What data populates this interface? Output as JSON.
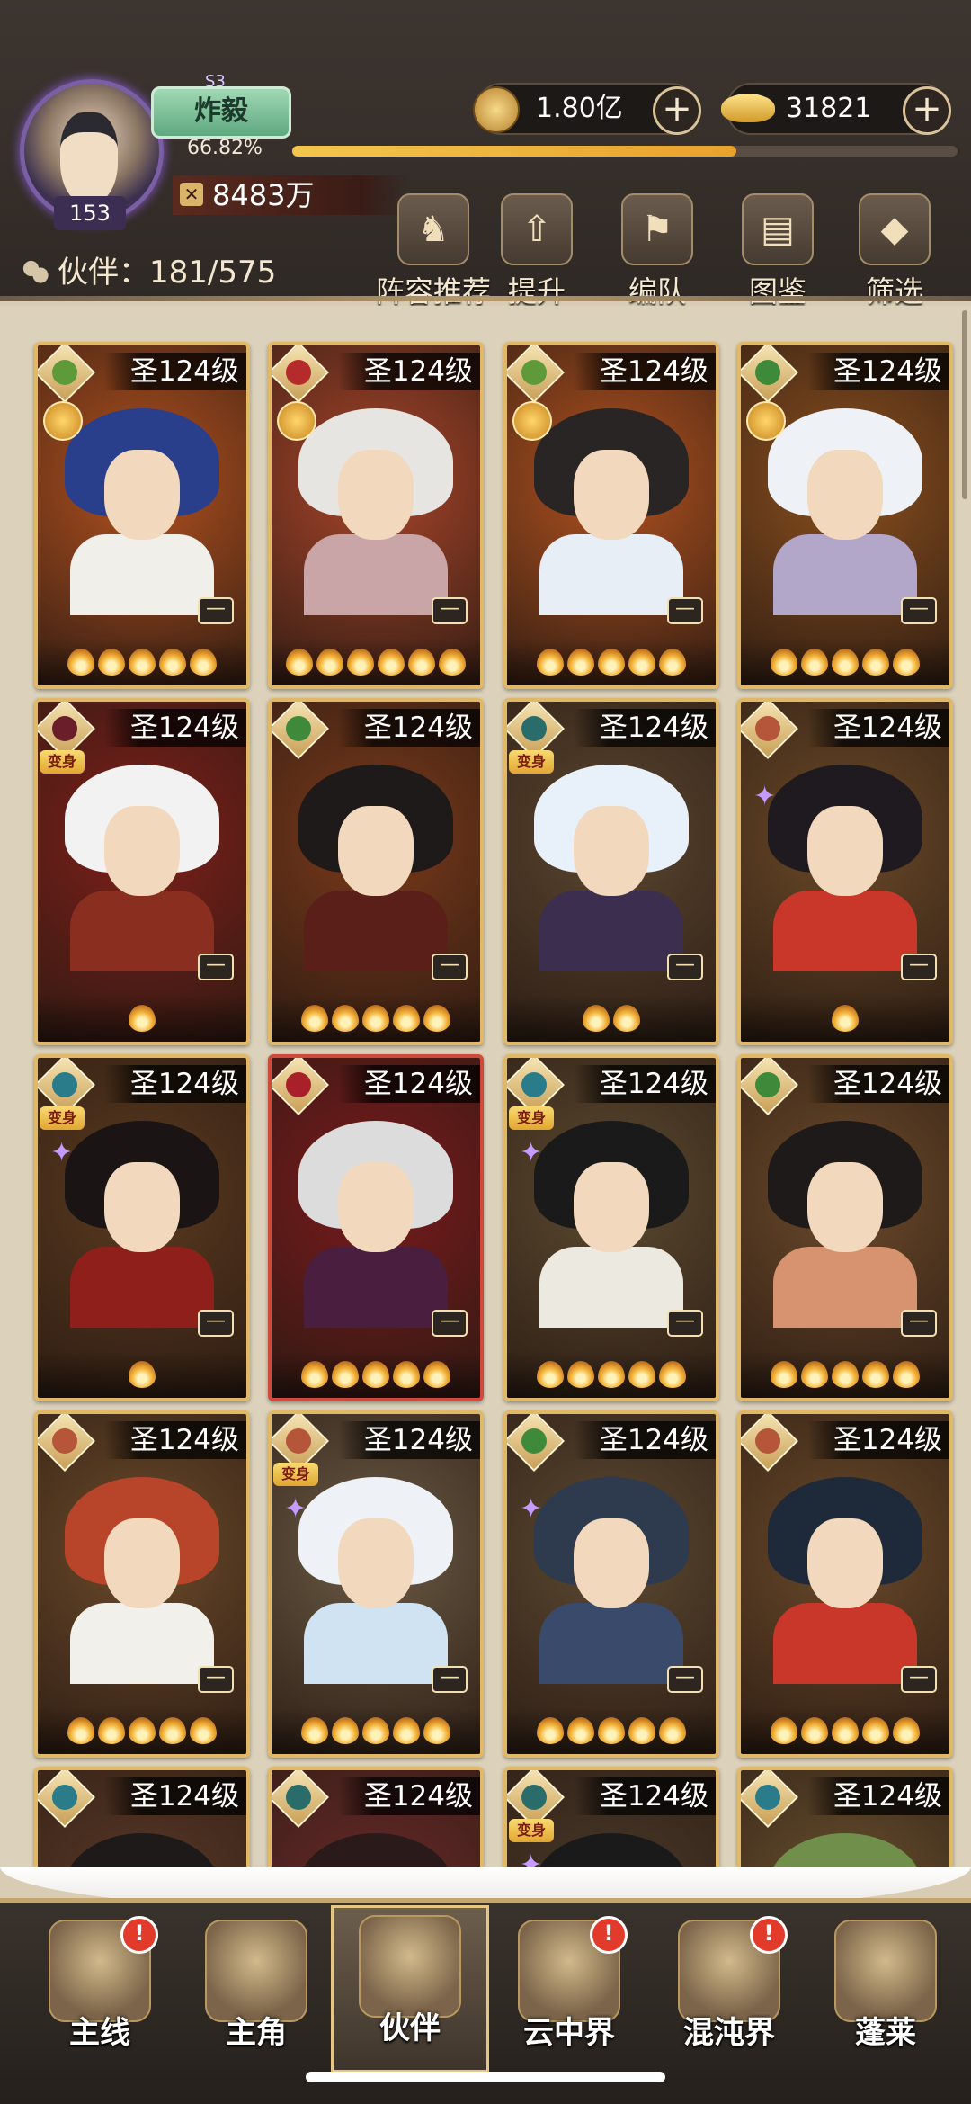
{
  "header": {
    "rank_tag": "S3",
    "title_badge": "炸毅",
    "exp_percent_text": "66.82%",
    "exp_fraction": 0.6682,
    "player_level": "153",
    "power_value": "8483万",
    "coins_value": "1.80亿",
    "ingots_value": "31821",
    "partner_count_label": "伙伴：181/575",
    "toolbar": [
      {
        "label": "阵容推荐",
        "icon": "lineup-recommend-icon"
      },
      {
        "label": "提升",
        "icon": "upgrade-icon"
      },
      {
        "label": "编队",
        "icon": "formation-icon"
      },
      {
        "label": "图鉴",
        "icon": "codex-icon"
      },
      {
        "label": "筛选",
        "icon": "filter-icon"
      }
    ]
  },
  "partners": [
    {
      "level": "圣124级",
      "tag": "",
      "flames": 5,
      "frame": "gold",
      "bg": "#b3511f",
      "hair": "#2a3f8c",
      "body": "#f0efe9",
      "elem": "#5f9a3a",
      "medal": true
    },
    {
      "level": "圣124级",
      "tag": "",
      "flames": 6,
      "frame": "gold",
      "bg": "#a9452a",
      "hair": "#e7e5e2",
      "body": "#c9a5a8",
      "elem": "#b52a2a",
      "medal": true
    },
    {
      "level": "圣124级",
      "tag": "",
      "flames": 5,
      "frame": "gold",
      "bg": "#b1521f",
      "hair": "#2a2525",
      "body": "#e8eef6",
      "elem": "#5f9a3a",
      "medal": true
    },
    {
      "level": "圣124级",
      "tag": "",
      "flames": 5,
      "frame": "gold",
      "bg": "#8a4f1e",
      "hair": "#eef1f6",
      "body": "#b2a6c9",
      "elem": "#3f8a3a",
      "medal": true
    },
    {
      "level": "圣124级",
      "tag": "变身",
      "flames": 1,
      "frame": "gold",
      "bg": "#7f1f1a",
      "hair": "#f2f2f2",
      "body": "#8a2e1f",
      "elem": "#6a1e2a",
      "medal": false
    },
    {
      "level": "圣124级",
      "tag": "",
      "flames": 5,
      "frame": "gold",
      "bg": "#7b3a1a",
      "hair": "#1f1a1a",
      "body": "#5b1f1a",
      "elem": "#3f8a3a",
      "medal": false
    },
    {
      "level": "圣124级",
      "tag": "变身",
      "flames": 2,
      "frame": "gold",
      "bg": "#5a4630",
      "hair": "#e8f0fa",
      "body": "#3b2e4e",
      "elem": "#2a6c6a",
      "medal": false
    },
    {
      "level": "圣124级",
      "tag": "",
      "flames": 1,
      "frame": "gold",
      "bg": "#6b4a28",
      "hair": "#1f1a1f",
      "body": "#c8372a",
      "elem": "#b5563a",
      "medal": false,
      "sparkle": true
    },
    {
      "level": "圣124级",
      "tag": "变身",
      "flames": 1,
      "frame": "gold",
      "bg": "#5a3a1f",
      "hair": "#1a1414",
      "body": "#8f1f1a",
      "elem": "#2a7c8a",
      "medal": false,
      "sparkle": true
    },
    {
      "level": "圣124级",
      "tag": "",
      "flames": 5,
      "frame": "red",
      "bg": "#7a1a1c",
      "hair": "#dcdcdc",
      "body": "#4a1e3e",
      "elem": "#a8202a",
      "medal": false
    },
    {
      "level": "圣124级",
      "tag": "变身",
      "flames": 5,
      "frame": "gold",
      "bg": "#5b4a30",
      "hair": "#1a1a1a",
      "body": "#ece9e1",
      "elem": "#2a7c8a",
      "medal": false,
      "sparkle": true
    },
    {
      "level": "圣124级",
      "tag": "",
      "flames": 5,
      "frame": "gold",
      "bg": "#6b4a2a",
      "hair": "#1f1a1a",
      "body": "#d7936f",
      "elem": "#3f8a3a",
      "medal": false
    },
    {
      "level": "圣124级",
      "tag": "",
      "flames": 5,
      "frame": "gold",
      "bg": "#6b4a2a",
      "hair": "#b8452a",
      "body": "#f2f0ea",
      "elem": "#b5563a",
      "medal": false
    },
    {
      "level": "圣124级",
      "tag": "变身",
      "flames": 5,
      "frame": "gold",
      "bg": "#6a5a44",
      "hair": "#eef2f7",
      "body": "#cfe3f2",
      "elem": "#b5563a",
      "medal": false,
      "sparkle": true
    },
    {
      "level": "圣124级",
      "tag": "",
      "flames": 5,
      "frame": "gold",
      "bg": "#5c4a32",
      "hair": "#2e3a4e",
      "body": "#3a4a6a",
      "elem": "#3f8a3a",
      "medal": false,
      "sparkle": true
    },
    {
      "level": "圣124级",
      "tag": "",
      "flames": 5,
      "frame": "gold",
      "bg": "#6a4a2a",
      "hair": "#1e2a3a",
      "body": "#c8372a",
      "elem": "#b5563a",
      "medal": false
    },
    {
      "level": "圣124级",
      "tag": "",
      "flames": 0,
      "frame": "gold",
      "bg": "#5b3a28",
      "hair": "#1f1a1a",
      "body": "#5b3a28",
      "elem": "#2a7c8a",
      "medal": false
    },
    {
      "level": "圣124级",
      "tag": "",
      "flames": 0,
      "frame": "gold",
      "bg": "#6a2a2a",
      "hair": "#2a1a1a",
      "body": "#6a2a2a",
      "elem": "#2a6c6a",
      "medal": false
    },
    {
      "level": "圣124级",
      "tag": "变身",
      "flames": 0,
      "frame": "gold",
      "bg": "#4a3a2a",
      "hair": "#1a1a1a",
      "body": "#4a3a2a",
      "elem": "#2a6c6a",
      "medal": false,
      "sparkle": true
    },
    {
      "level": "圣124级",
      "tag": "",
      "flames": 0,
      "frame": "gold",
      "bg": "#6a5230",
      "hair": "#6f8f4a",
      "body": "#6a5230",
      "elem": "#2a7c8a",
      "medal": false
    }
  ],
  "nav": [
    {
      "label": "主线",
      "badge": "!",
      "active": false
    },
    {
      "label": "主角",
      "badge": "",
      "active": false
    },
    {
      "label": "伙伴",
      "badge": "",
      "active": true
    },
    {
      "label": "云中界",
      "badge": "!",
      "active": false
    },
    {
      "label": "混沌界",
      "badge": "!",
      "active": false
    },
    {
      "label": "蓬莱",
      "badge": "",
      "active": false
    }
  ]
}
